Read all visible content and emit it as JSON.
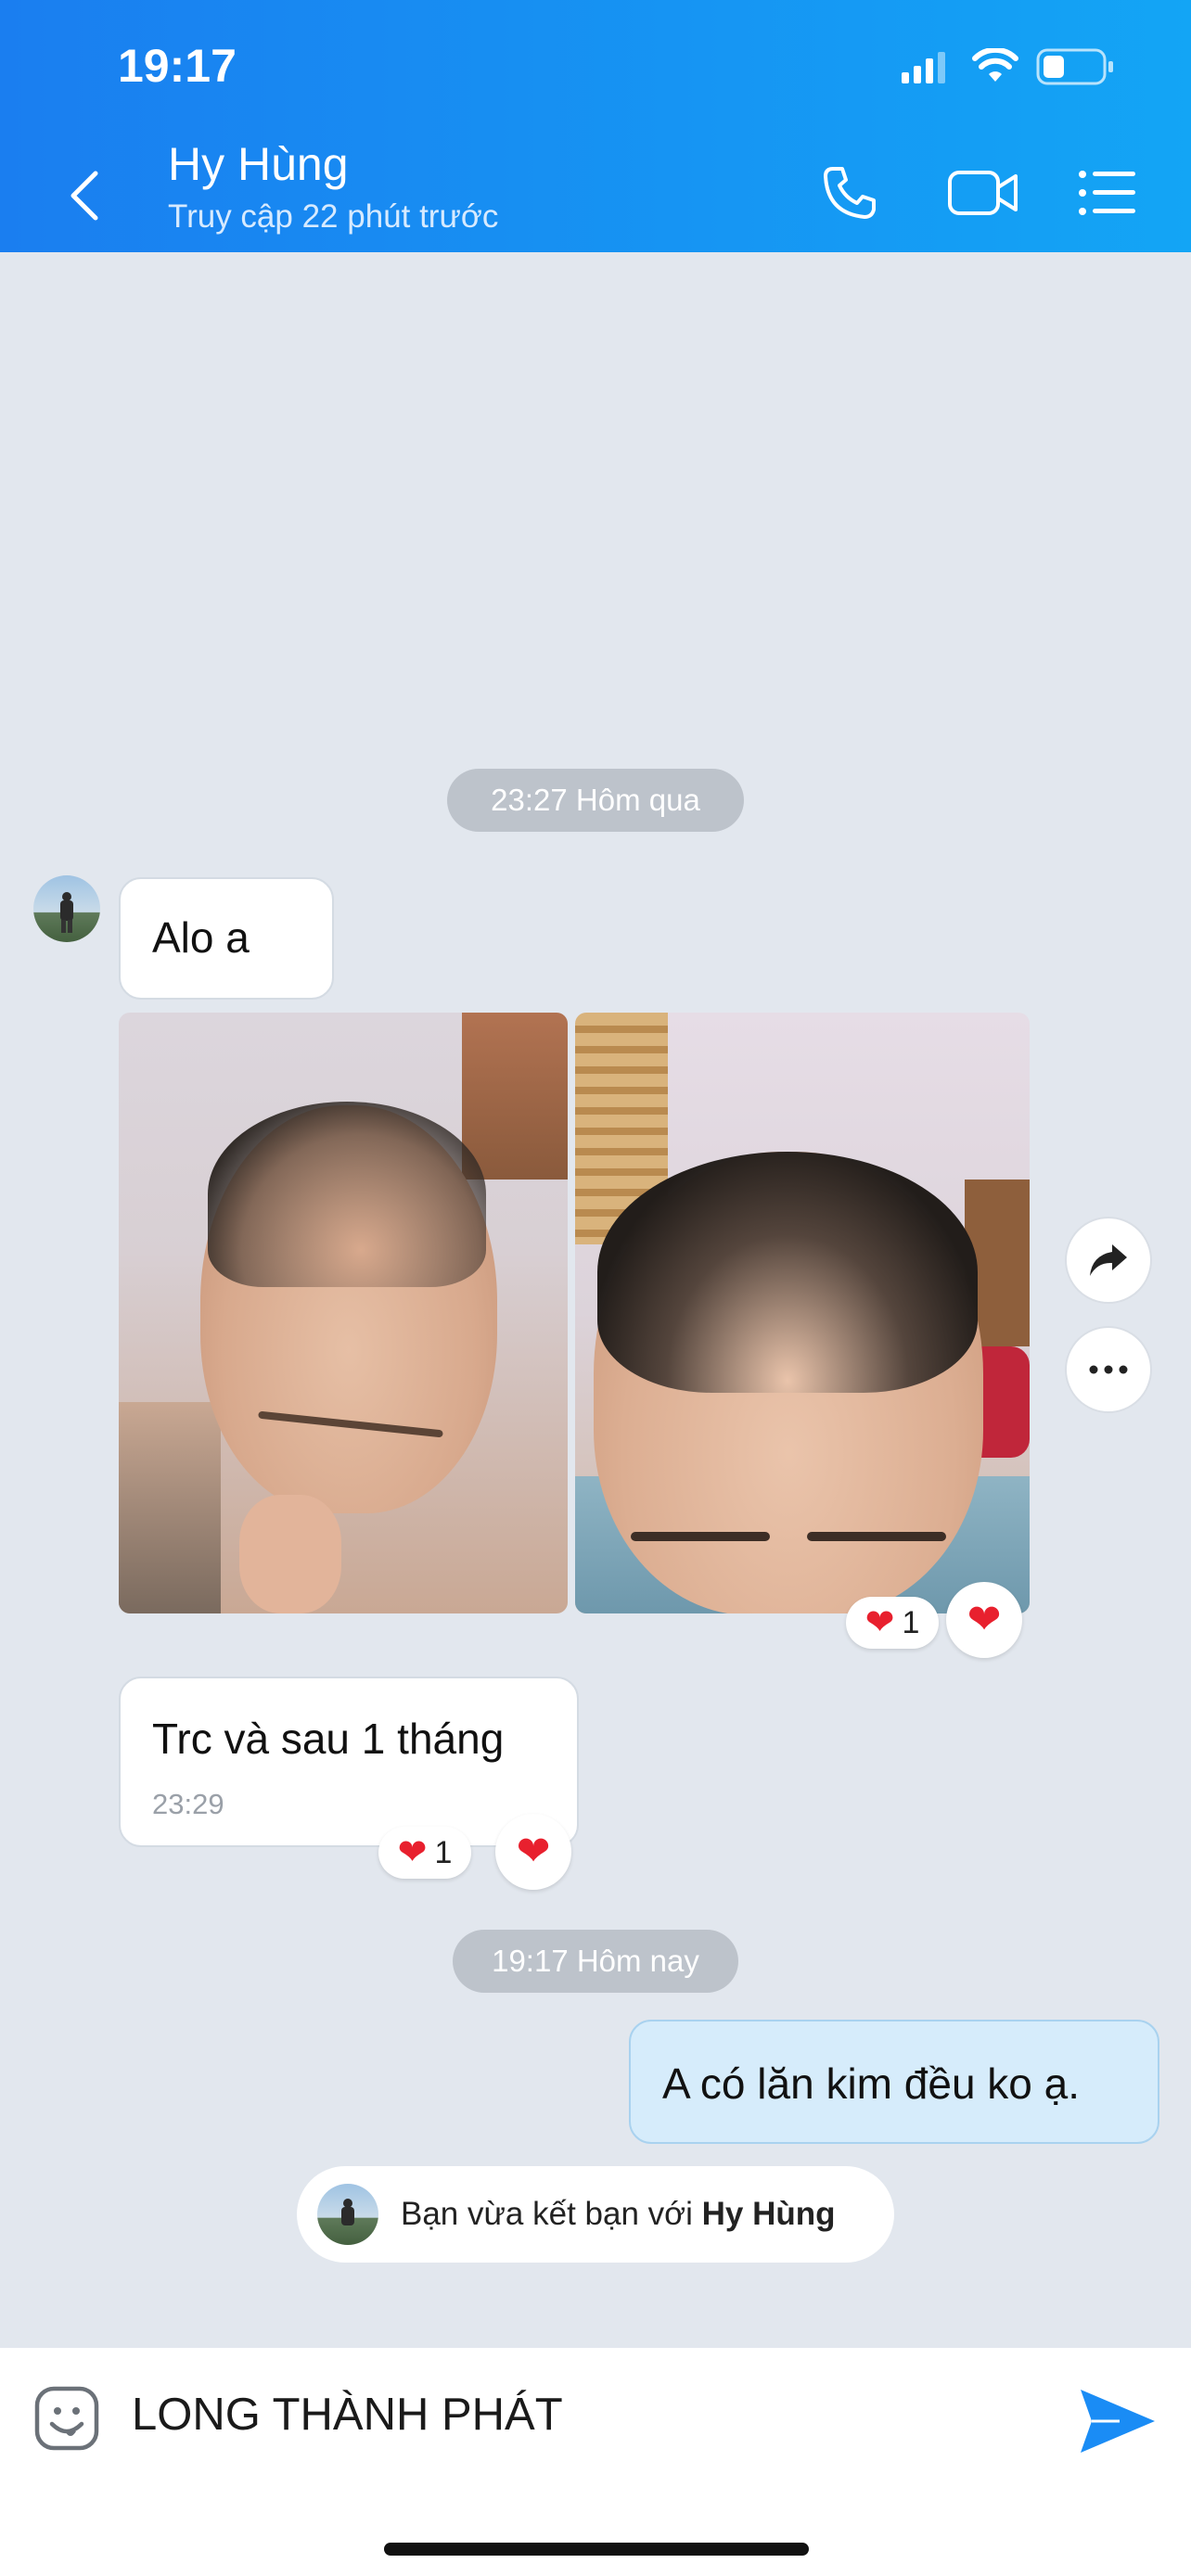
{
  "status_bar": {
    "time": "19:17"
  },
  "header": {
    "name": "Hy Hùng",
    "status": "Truy cập 22 phút trước"
  },
  "chat": {
    "date_pill_1": "23:27 Hôm qua",
    "msg_1": "Alo a",
    "photo_reaction_count": "1",
    "msg_2": "Trc và sau 1 tháng",
    "msg_2_time": "23:29",
    "msg_2_reaction_count": "1",
    "date_pill_2": "19:17 Hôm nay",
    "msg_3": "A có lăn kim đều ko ạ.",
    "friend_notice_prefix": "Bạn vừa kết bạn với ",
    "friend_notice_name": "Hy Hùng"
  },
  "composer": {
    "value": "LONG THÀNH PHÁT"
  },
  "colors": {
    "header_start": "#1a7ef0",
    "header_end": "#13a5f5",
    "send": "#1a8cf5",
    "heart": "#e8202e"
  },
  "icons": [
    "back-icon",
    "phone-icon",
    "video-call-icon",
    "menu-icon",
    "share-icon",
    "more-icon",
    "sticker-icon",
    "send-icon",
    "heart-icon"
  ]
}
